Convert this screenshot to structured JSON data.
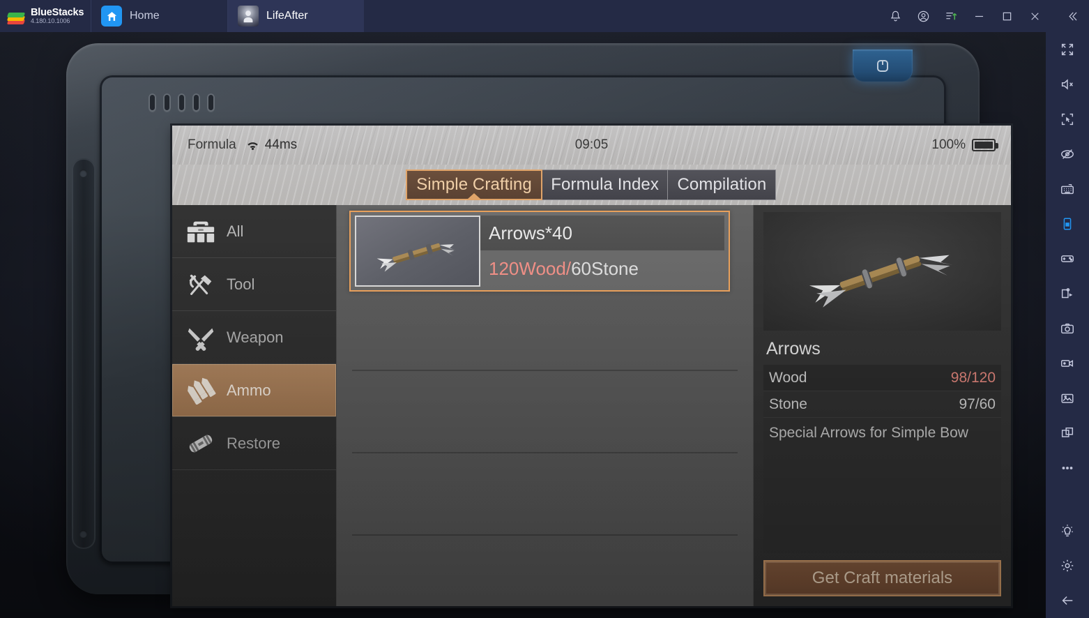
{
  "bluestacks": {
    "brand_name": "BlueStacks",
    "version": "4.180.10.1006",
    "tabs": [
      {
        "label": "Home",
        "icon": "home-icon",
        "active": false
      },
      {
        "label": "LifeAfter",
        "icon": "avatar-icon",
        "active": true
      }
    ],
    "window_actions": [
      {
        "name": "notifications-icon"
      },
      {
        "name": "account-icon"
      },
      {
        "name": "upload-icon"
      },
      {
        "name": "minimize-icon"
      },
      {
        "name": "maximize-icon"
      },
      {
        "name": "close-icon"
      },
      {
        "name": "collapse-icon"
      }
    ],
    "sidebar_icons": [
      "fullscreen-icon",
      "mute-icon",
      "screen-select-icon",
      "eye-off-icon",
      "keyboard-icon",
      "phone-icon",
      "gamepad-icon",
      "script-play-icon",
      "camera-icon",
      "video-record-icon",
      "media-gallery-icon",
      "multi-instance-icon",
      "more-options-icon",
      "lightbulb-icon",
      "settings-gear-icon",
      "back-arrow-icon"
    ]
  },
  "game": {
    "status_bar": {
      "title": "Formula",
      "ping": "44ms",
      "wifi_icon": "wifi-icon",
      "time": "09:05",
      "battery_percent": "100%",
      "battery_icon": "battery-full-icon"
    },
    "tabs": [
      {
        "label": "Simple Crafting",
        "active": true
      },
      {
        "label": "Formula Index",
        "active": false
      },
      {
        "label": "Compilation",
        "active": false
      }
    ],
    "categories": [
      {
        "label": "All",
        "icon": "toolbox-icon",
        "active": false
      },
      {
        "label": "Tool",
        "icon": "hammer-pliers-icon",
        "active": false
      },
      {
        "label": "Weapon",
        "icon": "crossed-knives-icon",
        "active": false
      },
      {
        "label": "Ammo",
        "icon": "bullets-icon",
        "active": true
      },
      {
        "label": "Restore",
        "icon": "bandage-icon",
        "active": false
      }
    ],
    "recipes": [
      {
        "name": "Arrows*40",
        "cost_lacking": "120Wood",
        "cost_separator": "/",
        "cost_available": "60Stone",
        "thumb_icon": "arrow-bundle-icon",
        "selected": true
      }
    ],
    "detail": {
      "art_icon": "arrow-bundle-icon",
      "title": "Arrows",
      "materials": [
        {
          "name": "Wood",
          "value": "98/120",
          "sufficient": false
        },
        {
          "name": "Stone",
          "value": "97/60",
          "sufficient": true
        }
      ],
      "description": "Special Arrows for Simple Bow",
      "craft_button": "Get Craft materials"
    }
  },
  "device": {
    "power_button_icon": "power-eject-icon",
    "nav_keys": [
      {
        "name": "back-key",
        "icon": "back-arrow-icon"
      },
      {
        "name": "home-key",
        "icon": "home-chevron-icon"
      }
    ]
  },
  "colors": {
    "accent_orange": "#e8a05c",
    "category_active": "#b58a63",
    "lacking_red": "#ef8f86",
    "bluestacks_bg": "#242a45",
    "blue_accent": "#2196f3"
  }
}
